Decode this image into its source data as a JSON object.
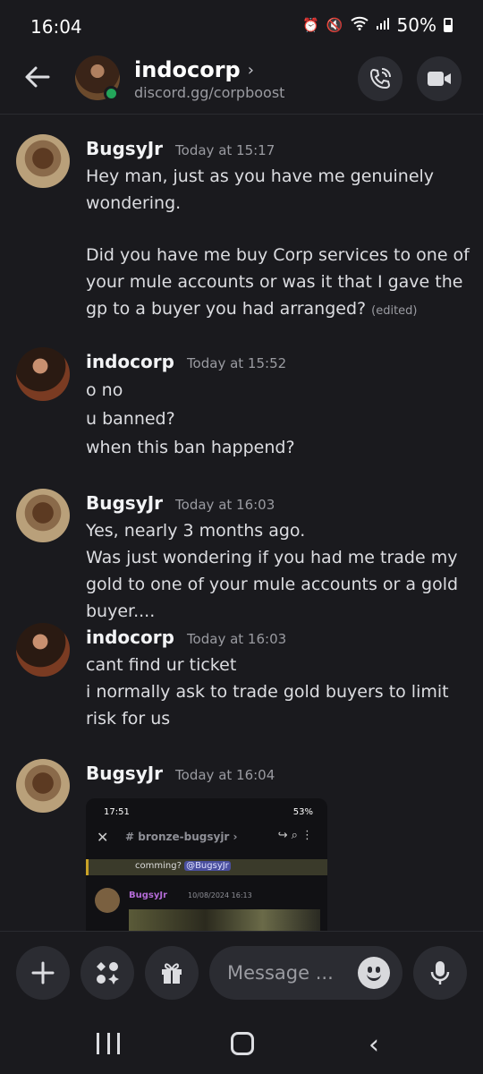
{
  "status_bar": {
    "time": "16:04",
    "battery": "50%",
    "icons": [
      "alarm-icon",
      "mute-icon",
      "wifi-icon",
      "signal-icon",
      "battery-icon"
    ]
  },
  "header": {
    "name": "indocorp",
    "chevron": "›",
    "subtitle": "discord.gg/corpboost",
    "online_color": "#23a55a"
  },
  "messages": [
    {
      "author": "BugsyJr",
      "time": "Today at 15:17",
      "paragraphs": [
        "Hey man, just as you have me genuinely wondering.",
        "Did you have me buy Corp services to one of your mule accounts or was it that I gave the gp to a buyer you had arranged?"
      ],
      "edited": "(edited)"
    },
    {
      "author": "indocorp",
      "time": "Today at 15:52",
      "lines": [
        "o no",
        "u banned?",
        "when this ban happend?"
      ]
    },
    {
      "author": "BugsyJr",
      "time": "Today at 16:03",
      "lines": [
        "Yes, nearly 3 months ago.",
        "Was just wondering if you had me trade my gold to one of your mule accounts or a gold buyer...."
      ]
    },
    {
      "author": "indocorp",
      "time": "Today at 16:03",
      "lines": [
        "cant find ur ticket",
        "i normally ask to trade gold buyers to limit risk for us"
      ]
    },
    {
      "author": "BugsyJr",
      "time": "Today at 16:04",
      "attachment": {
        "status_time": "17:51",
        "status_battery": "53%",
        "channel": "# bronze-bugsyjr ›",
        "banner_text": "comming?",
        "mention": "@BugsyJr",
        "author": "BugsyJr",
        "date": "10/08/2024 16:13"
      }
    }
  ],
  "composer": {
    "placeholder": "Message ..."
  }
}
